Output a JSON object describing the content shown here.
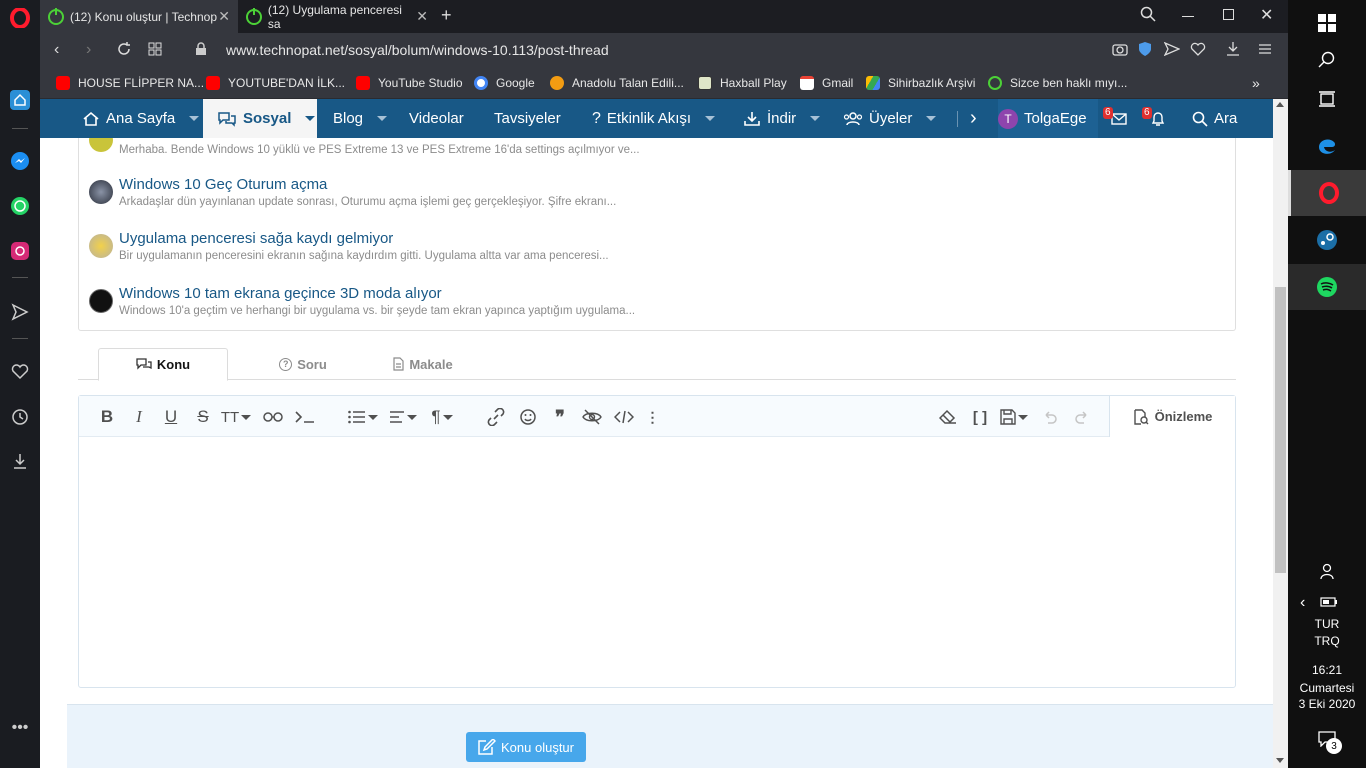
{
  "browser": {
    "tabs": [
      {
        "title": "(12) Konu oluştur | Technop"
      },
      {
        "title": "(12) Uygulama penceresi sa"
      }
    ],
    "new_tab": "+",
    "url": "www.technopat.net/sosyal/bolum/windows-10.113/post-thread",
    "bookmarks": [
      {
        "label": "HOUSE FLİPPER NA...",
        "icon": "youtube-icon"
      },
      {
        "label": "YOUTUBE'DAN İLK...",
        "icon": "youtube-icon"
      },
      {
        "label": "YouTube Studio",
        "icon": "youtube-icon"
      },
      {
        "label": "Google",
        "icon": "google-icon"
      },
      {
        "label": "Anadolu Talan Edili...",
        "icon": "info-icon"
      },
      {
        "label": "Haxball Play",
        "icon": "haxball-icon"
      },
      {
        "label": "Gmail",
        "icon": "gmail-icon"
      },
      {
        "label": "Sihirbazlık Arşivi",
        "icon": "drive-icon"
      },
      {
        "label": "Sizce ben haklı mıyı...",
        "icon": "power-icon"
      }
    ],
    "bookmarks_more": "»"
  },
  "nav": {
    "items": [
      {
        "label": "Ana Sayfa"
      },
      {
        "label": "Sosyal"
      },
      {
        "label": "Blog"
      },
      {
        "label": "Videolar"
      },
      {
        "label": "Tavsiyeler"
      },
      {
        "label": "Etkinlik Akışı"
      },
      {
        "label": "İndir"
      },
      {
        "label": "Üyeler"
      }
    ],
    "user": "TolgaEge",
    "user_initial": "T",
    "inbox_count": "6",
    "alerts_count": "6",
    "search": "Ara"
  },
  "similar_threads": [
    {
      "title": "",
      "snippet": "Merhaba. Bende Windows 10 yüklü ve PES Extreme 13 ve PES Extreme 16'da settings açılmıyor ve..."
    },
    {
      "title": "Windows 10 Geç Oturum açma",
      "snippet": "Arkadaşlar dün yayınlanan update sonrası, Oturumu açma işlemi geç gerçekleşiyor. Şifre ekranı..."
    },
    {
      "title": "Uygulama penceresi sağa kaydı gelmiyor",
      "snippet": "Bir uygulamanın penceresini ekranın sağına kaydırdım gitti. Uygulama altta var ama penceresi..."
    },
    {
      "title": "Windows 10 tam ekrana geçince 3D moda alıyor",
      "snippet": "Windows 10'a geçtim ve herhangi bir uygulama vs. bir şeyde tam ekran yapınca yaptığım uygulama..."
    }
  ],
  "thread_types": [
    {
      "label": "Konu"
    },
    {
      "label": "Soru"
    },
    {
      "label": "Makale"
    }
  ],
  "editor": {
    "preview_label": "Önizleme"
  },
  "submit_label": "Konu oluştur",
  "taskbar": {
    "lang_1": "TUR",
    "lang_2": "TRQ",
    "time": "16:21",
    "day": "Cumartesi",
    "date": "3 Eki 2020",
    "notif_count": "3"
  },
  "colors": {
    "nav_bg": "#185886",
    "link": "#185886",
    "submit_bg": "#47a7eb",
    "badge": "#e03030",
    "opera_red": "#ff1b2d"
  }
}
